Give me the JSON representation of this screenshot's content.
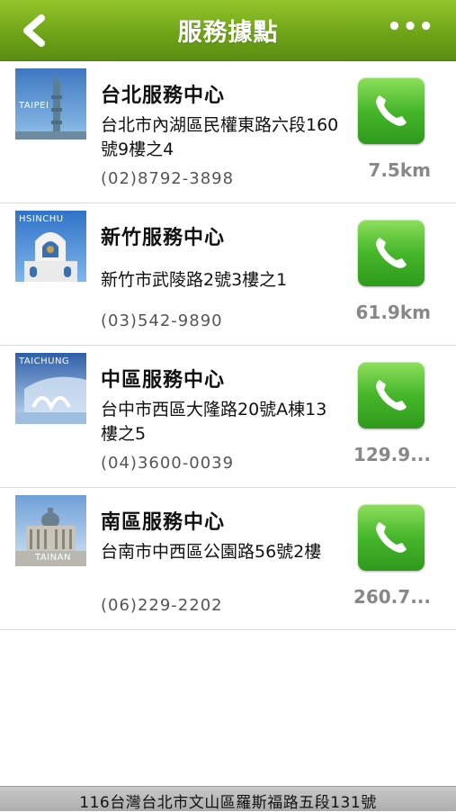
{
  "header": {
    "title": "服務據點",
    "back_icon": "chevron-left-icon",
    "more_label": "•••"
  },
  "locations": [
    {
      "thumb_label": "TAIPEI",
      "name": "台北服務中心",
      "address": "台北市內湖區民權東路六段160號9樓之4",
      "phone": "(02)8792-3898",
      "distance": "7.5km"
    },
    {
      "thumb_label": "HSINCHU",
      "name": "新竹服務中心",
      "address": "新竹市武陵路2號3樓之1",
      "phone": "(03)542-9890",
      "distance": "61.9km"
    },
    {
      "thumb_label": "TAICHUNG",
      "name": "中區服務中心",
      "address": "台中市西區大隆路20號A棟13樓之5",
      "phone": "(04)3600-0039",
      "distance": "129.9..."
    },
    {
      "thumb_label": "TAINAN",
      "name": "南區服務中心",
      "address": "台南市中西區公園路56號2樓",
      "phone": "(06)229-2202",
      "distance": "260.7..."
    }
  ],
  "footer": {
    "address": "116台灣台北市文山區羅斯福路五段131號"
  },
  "colors": {
    "header_green": "#6fa418",
    "call_green": "#46b62a",
    "distance_gray": "#888888"
  }
}
